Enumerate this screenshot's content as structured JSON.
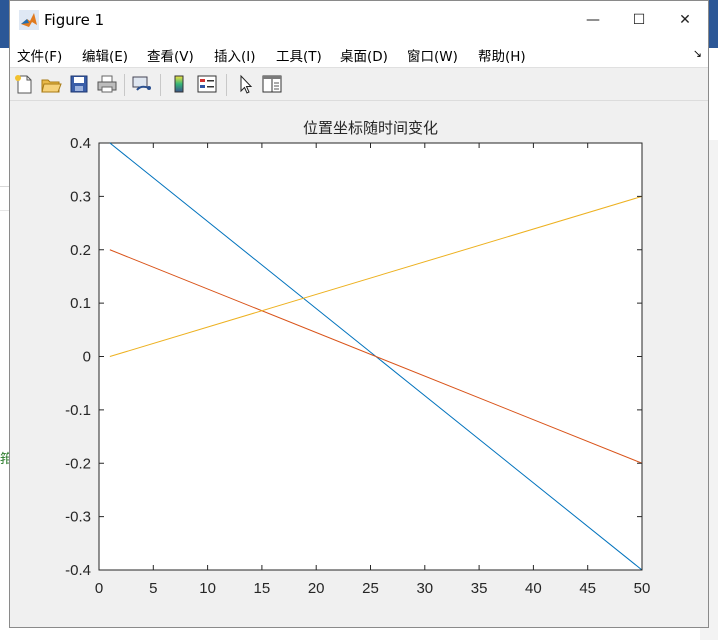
{
  "window": {
    "title": "Figure 1",
    "controls": {
      "minimize": "—",
      "maximize": "☐",
      "close": "✕"
    }
  },
  "menu": {
    "items": [
      "文件(F)",
      "编辑(E)",
      "查看(V)",
      "插入(I)",
      "工具(T)",
      "桌面(D)",
      "窗口(W)",
      "帮助(H)"
    ],
    "overflow_glyph": "↘"
  },
  "toolbar": {
    "buttons": [
      "new-figure-icon",
      "open-file-icon",
      "save-icon",
      "print-icon",
      "link-plot-icon",
      "insert-colorbar-icon",
      "insert-legend-icon",
      "edit-plot-arrow-icon",
      "property-inspector-icon"
    ]
  },
  "background": {
    "fragment_text": "箝"
  },
  "chart_data": {
    "type": "line",
    "title": "位置坐标随时间变化",
    "xlabel": "",
    "ylabel": "",
    "xlim": [
      0,
      50
    ],
    "ylim": [
      -0.4,
      0.4
    ],
    "xticks": [
      0,
      5,
      10,
      15,
      20,
      25,
      30,
      35,
      40,
      45,
      50
    ],
    "yticks": [
      -0.4,
      -0.3,
      -0.2,
      -0.1,
      0,
      0.1,
      0.2,
      0.3,
      0.4
    ],
    "xtick_labels": [
      "0",
      "5",
      "10",
      "15",
      "20",
      "25",
      "30",
      "35",
      "40",
      "45",
      "50"
    ],
    "ytick_labels": [
      "-0.4",
      "-0.3",
      "-0.2",
      "-0.1",
      "0",
      "0.1",
      "0.2",
      "0.3",
      "0.4"
    ],
    "grid": false,
    "series": [
      {
        "color": "#0072bd",
        "x": [
          1,
          50
        ],
        "y": [
          0.4,
          -0.4
        ]
      },
      {
        "color": "#d95319",
        "x": [
          1,
          50
        ],
        "y": [
          0.2,
          -0.2
        ]
      },
      {
        "color": "#edb120",
        "x": [
          1,
          50
        ],
        "y": [
          0.0,
          0.3
        ]
      }
    ]
  }
}
